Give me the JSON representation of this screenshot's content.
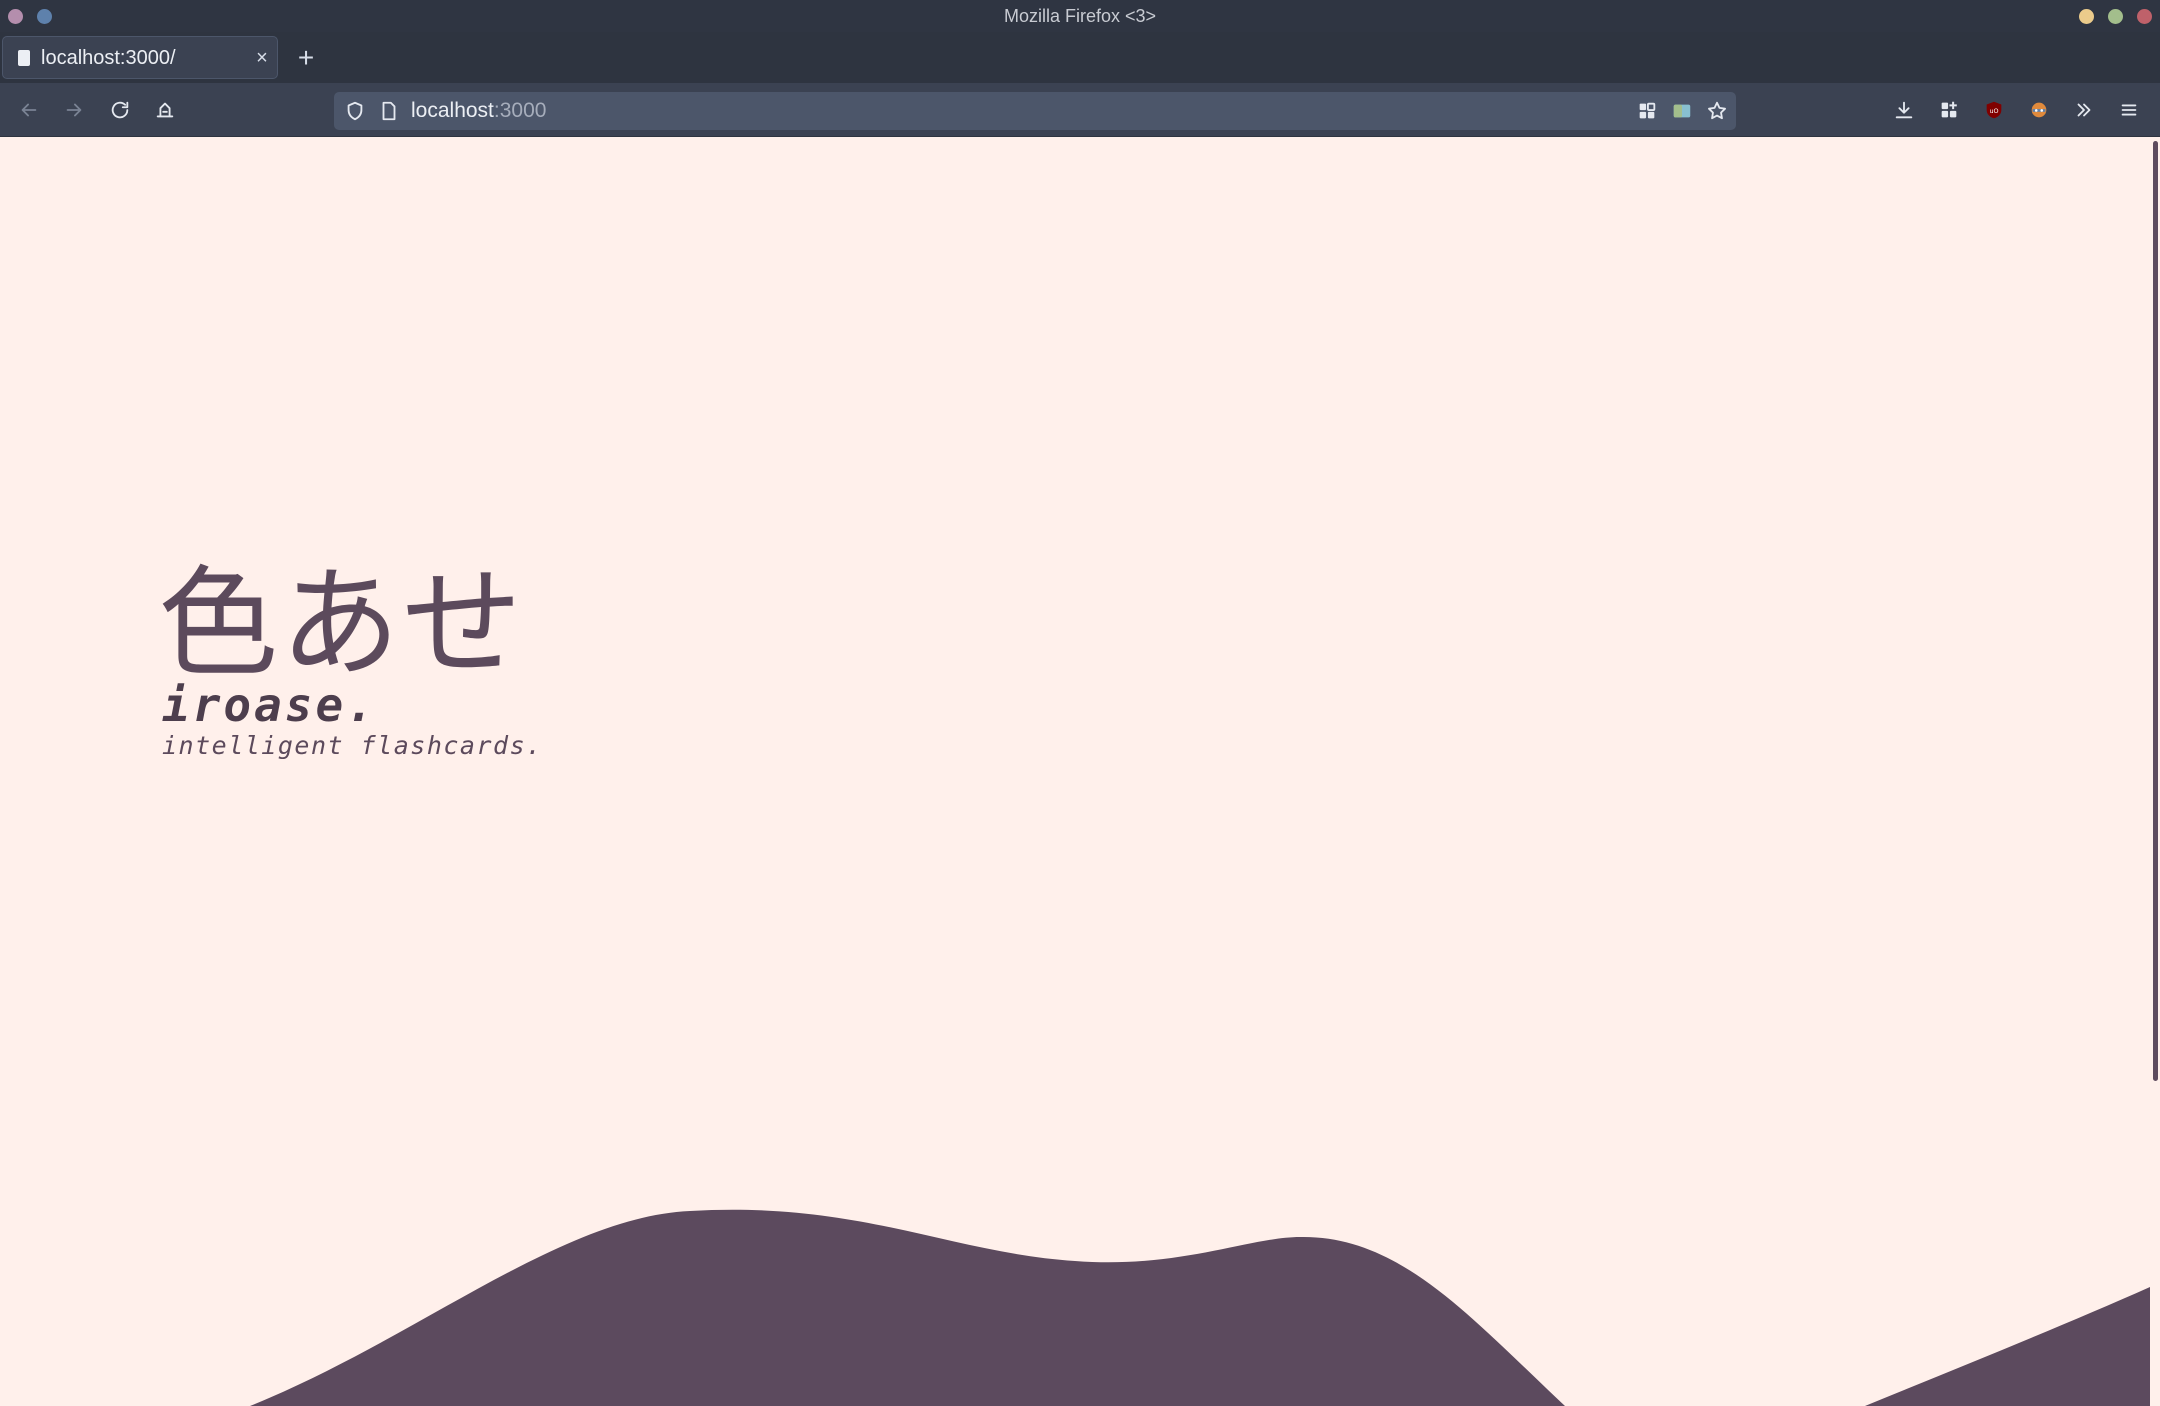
{
  "window": {
    "title": "Mozilla Firefox <3>"
  },
  "tabs": [
    {
      "label": "localhost:3000/",
      "active": true,
      "close_glyph": "×"
    }
  ],
  "new_tab_glyph": "+",
  "toolbar": {
    "back_icon": "arrow-left-icon",
    "forward_icon": "arrow-right-icon",
    "reload_icon": "reload-icon",
    "home_icon": "home-icon"
  },
  "urlbar": {
    "host": "localhost",
    "port": ":3000",
    "icons": [
      "shield-icon",
      "page-icon",
      "grid-icon",
      "reader-icon",
      "star-icon"
    ]
  },
  "toolbar_right_icons": [
    "download-icon",
    "extensions-icon",
    "ublock-icon",
    "privacy-badger-icon",
    "overflow-icon",
    "hamburger-menu-icon"
  ],
  "page": {
    "kanji": "色あせ",
    "brand": "iroase.",
    "tagline": "intelligent flashcards."
  },
  "colors": {
    "page_background": "#fff0eb",
    "accent": "#5c4a5c",
    "chrome_dark": "#2e3440",
    "chrome_mid": "#3b4252",
    "urlbar": "#4c566a"
  }
}
